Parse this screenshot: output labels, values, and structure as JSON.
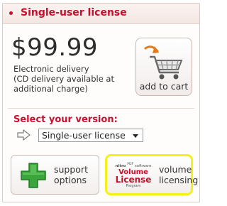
{
  "header": {
    "title": "Single-user license"
  },
  "pricing": {
    "price": "$99.99",
    "delivery_lines": [
      "Electronic delivery",
      "(CD delivery available at",
      "additional charge)"
    ]
  },
  "cart": {
    "label": "add to cart",
    "icon": "shopping-cart-icon"
  },
  "version": {
    "label": "Select your version:",
    "selected": "Single-user license",
    "arrow_icon": "right-arrow-icon"
  },
  "cards": {
    "support": {
      "lines": [
        "support",
        "options"
      ],
      "icon": "green-plus-icon"
    },
    "volume": {
      "lines": [
        "volume",
        "licensing"
      ],
      "logo": {
        "brand": "nitro",
        "tm": "PDF",
        "sub": "software",
        "line1": "Volume",
        "line2": "License",
        "line3": "Program"
      }
    }
  },
  "colors": {
    "accent": "#c8102e",
    "highlight_border": "#f2f21a",
    "plus_green": "#3aa53a",
    "cart_arrow": "#e07a1c"
  }
}
